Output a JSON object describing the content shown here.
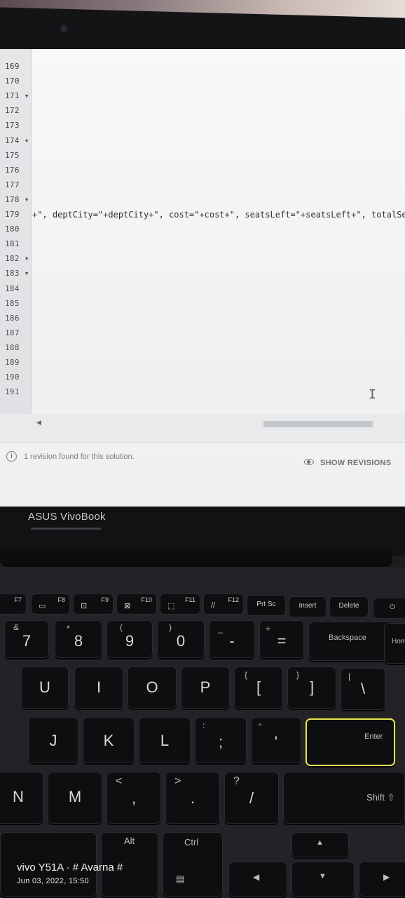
{
  "editor": {
    "line_numbers": [
      "169",
      "170",
      "171",
      "172",
      "173",
      "174",
      "175",
      "176",
      "177",
      "178",
      "179",
      "180",
      "181",
      "182",
      "183",
      "184",
      "185",
      "186",
      "187",
      "188",
      "189",
      "190",
      "191"
    ],
    "fold_markers": [
      "171",
      "174",
      "178",
      "182",
      "183"
    ],
    "code_line_179": "+\", deptCity=\"+deptCity+\", cost=\"+cost+\", seatsLeft=\"+seatsLeft+\", totalSe",
    "cursor_glyph": "I"
  },
  "footer": {
    "revision_text": "1 revision found for this solution.",
    "show_revisions_label": "SHOW REVISIONS",
    "info_icon": "i"
  },
  "laptop": {
    "brand": "ASUS VivoBook"
  },
  "keyboard": {
    "fkeys": [
      {
        "label": "F7",
        "icon": ""
      },
      {
        "label": "F8",
        "icon": "▭"
      },
      {
        "label": "F9",
        "icon": "⊡"
      },
      {
        "label": "F10",
        "icon": "⊠"
      },
      {
        "label": "F11",
        "icon": "⬚"
      },
      {
        "label": "F12",
        "icon": "//"
      },
      {
        "label": "",
        "icon": "",
        "text": "Prt Sc"
      },
      {
        "label": "",
        "icon": "",
        "text": "Insert"
      },
      {
        "label": "",
        "icon": "",
        "text": "Delete"
      },
      {
        "label": "",
        "icon": "⏻",
        "text": ""
      }
    ],
    "row_numbers": [
      {
        "main": "7",
        "sub": "&"
      },
      {
        "main": "8",
        "sub": "*"
      },
      {
        "main": "9",
        "sub": "("
      },
      {
        "main": "0",
        "sub": ")"
      },
      {
        "main": "-",
        "sub": "_"
      },
      {
        "main": "=",
        "sub": "+"
      }
    ],
    "backspace": "Backspace",
    "home": "Hom",
    "row_upper": [
      "U",
      "I",
      "O",
      "P"
    ],
    "bracket_open": {
      "main": "[",
      "sub": "{"
    },
    "bracket_close": {
      "main": "]",
      "sub": "}"
    },
    "backslash": {
      "main": "\\",
      "sub": "|"
    },
    "row_home": [
      "J",
      "K",
      "L"
    ],
    "semicolon": {
      "main": ";",
      "sub": ":"
    },
    "quote": {
      "main": "'",
      "sub": "\""
    },
    "enter": "Enter",
    "row_lower": [
      "N",
      "M"
    ],
    "comma": {
      "main": ",",
      "sub": "<"
    },
    "period": {
      "main": ".",
      "sub": ">"
    },
    "slash": {
      "main": "/",
      "sub": "?"
    },
    "shift": "Shift ⇧",
    "alt": "Alt",
    "ctrl": "Ctrl",
    "arrow_up": "▲",
    "arrow_left": "◀",
    "arrow_down": "▼",
    "arrow_right": "▶"
  },
  "watermark": {
    "device": "vivo Y51A · # Avarna #",
    "timestamp": "Jun 03, 2022, 15:50"
  }
}
